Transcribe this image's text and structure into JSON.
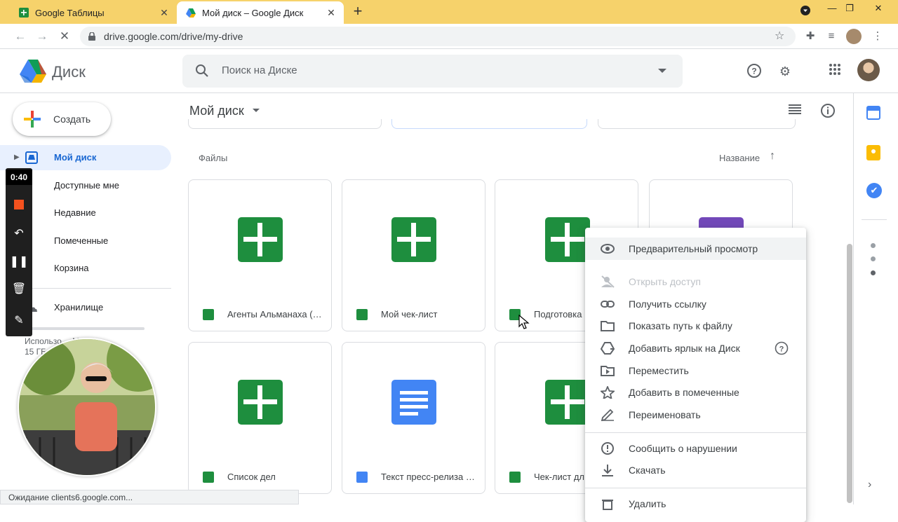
{
  "browser": {
    "tabs": [
      {
        "title": "Google Таблицы",
        "close": "✕"
      },
      {
        "title": "Мой диск – Google Диск",
        "close": "✕"
      }
    ],
    "new_tab": "+",
    "url": "drive.google.com/drive/my-drive"
  },
  "drive": {
    "brand": "Диск",
    "search_placeholder": "Поиск на Диске",
    "create_label": "Создать",
    "nav": [
      {
        "label": "Мой диск"
      },
      {
        "label": "Доступные мне"
      },
      {
        "label": "Недавние"
      },
      {
        "label": "Помеченные"
      },
      {
        "label": "Корзина"
      },
      {
        "label": "Хранилище"
      }
    ],
    "storage_text_line1": "Использо… МБ из",
    "storage_text_line2": "15 ГБ",
    "page_title": "Мой диск",
    "section_label": "Файлы",
    "sort_label": "Название",
    "files": [
      {
        "name": "Агенты Альманаха (…",
        "type": "sheet"
      },
      {
        "name": "Мой чек-лист",
        "type": "sheet"
      },
      {
        "name": "Подготовка",
        "type": "sheet"
      },
      {
        "name": "",
        "type": "form"
      },
      {
        "name": "Список дел",
        "type": "sheet"
      },
      {
        "name": "Текст пресс-релиза …",
        "type": "doc"
      },
      {
        "name": "Чек-лист дл",
        "type": "sheet"
      }
    ]
  },
  "context_menu": {
    "items": [
      {
        "label": "Предварительный просмотр",
        "icon": "eye-icon"
      },
      {
        "label": "Открыть доступ",
        "icon": "share-person-icon"
      },
      {
        "label": "Получить ссылку",
        "icon": "link-icon"
      },
      {
        "label": "Показать путь к файлу",
        "icon": "folder-icon"
      },
      {
        "label": "Добавить ярлык на Диск",
        "icon": "shortcut-icon"
      },
      {
        "label": "Переместить",
        "icon": "move-icon"
      },
      {
        "label": "Добавить в помеченные",
        "icon": "star-icon"
      },
      {
        "label": "Переименовать",
        "icon": "pencil-icon"
      },
      {
        "label": "Сообщить о нарушении",
        "icon": "report-icon"
      },
      {
        "label": "Скачать",
        "icon": "download-icon"
      },
      {
        "label": "Удалить",
        "icon": "trash-icon"
      }
    ]
  },
  "recorder": {
    "timer": "0:40"
  },
  "status_bar": "Ожидание clients6.google.com...",
  "colors": {
    "sheets_green": "#1e8e3e",
    "docs_blue": "#4285f4",
    "forms_purple": "#7248b9",
    "active_nav_bg": "#e8f0fe",
    "active_nav_text": "#1967d2",
    "tabbar": "#f6d26b"
  }
}
